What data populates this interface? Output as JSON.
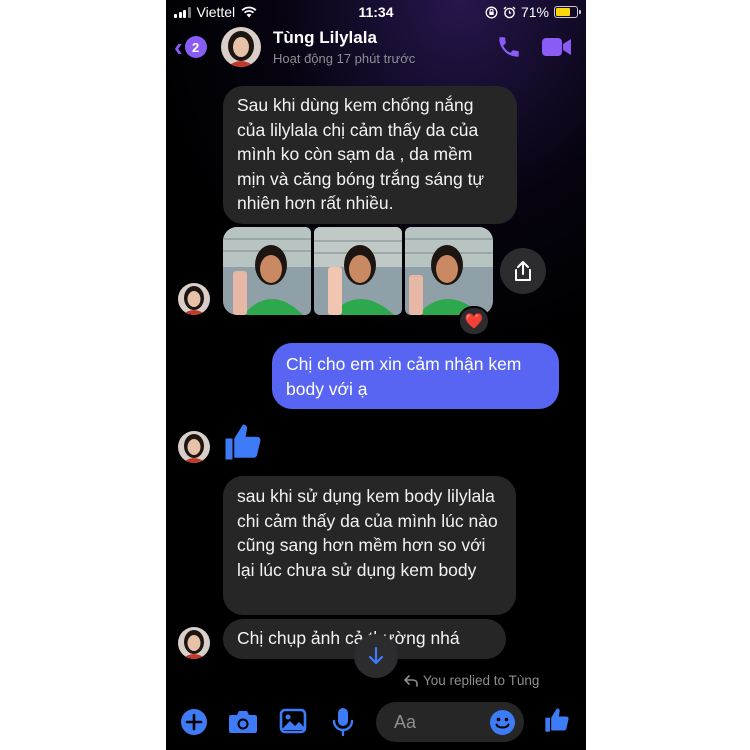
{
  "status_bar": {
    "carrier": "Viettel",
    "time": "11:34",
    "battery": "71%",
    "battery_level": 0.71
  },
  "header": {
    "back_badge": "2",
    "contact_name": "Tùng Lilylala",
    "contact_status": "Hoạt động 17 phút trước"
  },
  "messages": {
    "m1": "Sau khi dùng kem chống nắng của lilylala chị cảm thấy da của mình ko còn sạm da , da mềm mịn và căng bóng trắng sáng tự nhiên hơn rất nhiều.",
    "m2": "Chị cho em xin cảm nhận kem body với ạ",
    "m3": "sau khi sử dụng kem body lilylala chi cảm thấy da của mình lúc nào cũng sang hơn mềm hơn so với lại lúc chưa sử dụng kem body",
    "m4": "Chị chụp ảnh cả thường nhá"
  },
  "reaction": "❤️",
  "replied_note": "You replied to Tùng",
  "composer": {
    "placeholder": "Aa"
  },
  "colors": {
    "accent": "#8a5cf6",
    "outgoing_bubble": "#5865f2",
    "incoming_bubble": "#262626",
    "icon_blue": "#3d7bf7"
  }
}
